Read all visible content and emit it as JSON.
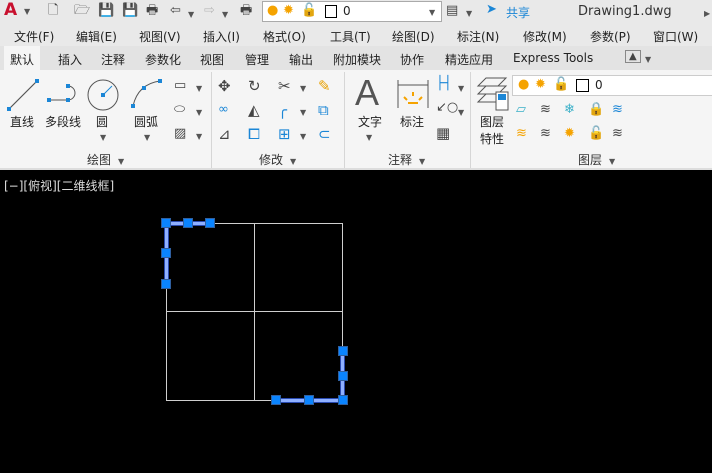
{
  "app": {
    "logo": "A",
    "title": "Drawing1.dwg",
    "share_label": "共享"
  },
  "quick_access": {
    "layer_value": "0",
    "icons": [
      "new-icon",
      "open-icon",
      "save-icon",
      "save-as-icon",
      "print-icon",
      "undo-icon",
      "redo-icon",
      "plot-icon"
    ]
  },
  "menu": [
    "文件(F)",
    "编辑(E)",
    "视图(V)",
    "插入(I)",
    "格式(O)",
    "工具(T)",
    "绘图(D)",
    "标注(N)",
    "修改(M)",
    "参数(P)",
    "窗口(W)"
  ],
  "tabs": [
    "默认",
    "插入",
    "注释",
    "参数化",
    "视图",
    "管理",
    "输出",
    "附加模块",
    "协作",
    "精选应用",
    "Express Tools"
  ],
  "active_tab": "默认",
  "ribbon": {
    "draw": {
      "title": "绘图",
      "line": "直线",
      "polyline": "多段线",
      "circle": "圆",
      "arc": "圆弧"
    },
    "modify": {
      "title": "修改"
    },
    "annotation": {
      "title": "注释",
      "text": "文字",
      "dimension": "标注"
    },
    "layers": {
      "title": "图层",
      "properties_line1": "图层",
      "properties_line2": "特性",
      "layer_value": "0"
    }
  },
  "viewport": {
    "label": "[−][俯视][二维线框]"
  },
  "colors": {
    "accent": "#0a84ff",
    "background": "#000000",
    "ribbon": "#f5f5f5",
    "bulb": "#f5a300"
  }
}
